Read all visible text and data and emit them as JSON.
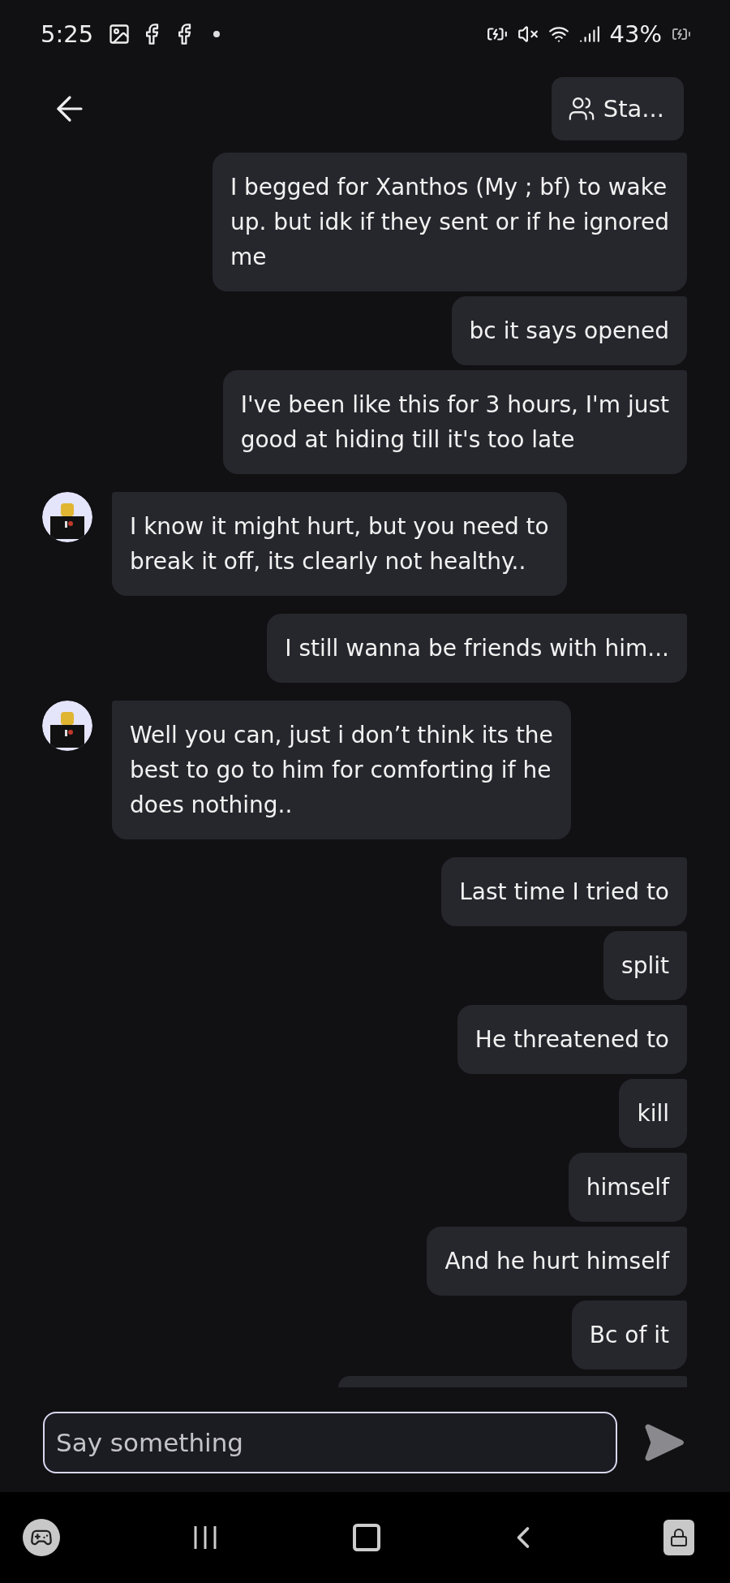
{
  "status_bar": {
    "time": "5:25",
    "battery": "43%"
  },
  "header": {
    "group_button": "Sta..."
  },
  "messages": [
    {
      "kind": "sent",
      "text": "I begged for Xanthos (My ; bf) to wake\nup. but idk if they sent or if he ignored\nme"
    },
    {
      "kind": "sent",
      "text": "bc it says opened"
    },
    {
      "kind": "sent",
      "text": "I've been like this for 3 hours, I'm just\ngood at hiding till it's too late"
    },
    {
      "kind": "received",
      "text": "I know it might hurt, but you need to\nbreak it off, its clearly not healthy.."
    },
    {
      "kind": "sent",
      "text": "I still wanna be friends with him..."
    },
    {
      "kind": "received",
      "text": "Well you can, just i don’t think its the\nbest to go to him for comforting if he\ndoes nothing.."
    },
    {
      "kind": "sent",
      "text": "Last time I tried to"
    },
    {
      "kind": "sent",
      "text": "split"
    },
    {
      "kind": "sent",
      "text": "He threatened to"
    },
    {
      "kind": "sent",
      "text": "kill"
    },
    {
      "kind": "sent",
      "text": "himself"
    },
    {
      "kind": "sent",
      "text": "And he hurt himself"
    },
    {
      "kind": "sent",
      "text": "Bc of it"
    }
  ],
  "composer": {
    "placeholder": "Say something"
  }
}
